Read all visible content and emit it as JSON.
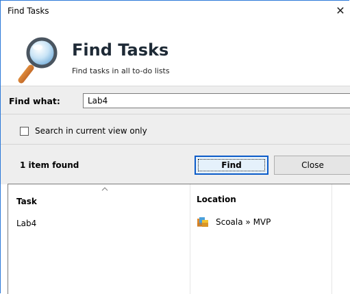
{
  "window": {
    "title": "Find Tasks",
    "close_glyph": "✕"
  },
  "header": {
    "title": "Find Tasks",
    "subtitle": "Find tasks in all to-do lists",
    "icon": "magnifier-icon"
  },
  "search": {
    "label": "Find what:",
    "value": "Lab4",
    "checkbox_label": "Search in current view only",
    "checkbox_checked": false
  },
  "status": {
    "result_text": "1 item found"
  },
  "buttons": {
    "find_label": "Find",
    "close_label": "Close"
  },
  "results": {
    "columns": [
      "Task",
      "Location"
    ],
    "rows": [
      {
        "task": "Lab4",
        "location": "Scoala » MVP",
        "location_icon": "folder-icon"
      }
    ]
  },
  "colors": {
    "accent": "#0a5ac8",
    "window_border": "#2b78d8",
    "panel_bg": "#eeeeee"
  }
}
